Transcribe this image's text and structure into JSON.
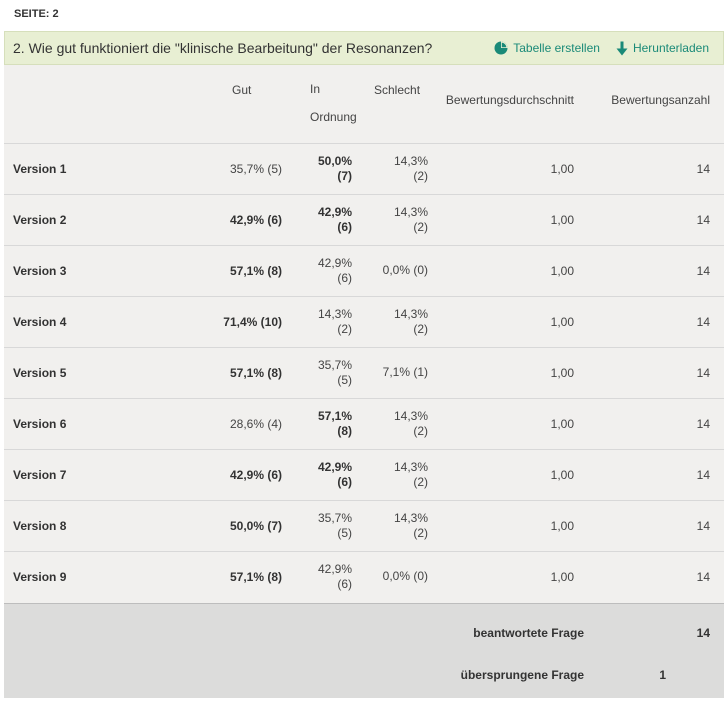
{
  "page": {
    "label": "SEITE: 2"
  },
  "question": {
    "title": "2. Wie gut funktioniert die \"klinische Bearbeitung\" der Resonanzen?",
    "actions": [
      {
        "label": "Tabelle erstellen",
        "icon": "pie-chart-icon"
      },
      {
        "label": "Herunterladen",
        "icon": "download-arrow-icon"
      }
    ]
  },
  "colors": {
    "accent": "#1a8a78",
    "title_bar": "#e8efd3",
    "table_bg": "#f1f0ee",
    "footer_bg": "#dcdcdb"
  },
  "table": {
    "headers": {
      "label": "",
      "gut": "Gut",
      "ok_line1": "In",
      "ok_line2": "Ordnung",
      "bad": "Schlecht",
      "avg": "Bewertungsdurchschnitt",
      "count": "Bewertungsanzahl"
    },
    "rows": [
      {
        "label": "Version 1",
        "gut": "35,7% (5)",
        "ok1": "50,0%",
        "ok2": "(7)",
        "bad1": "14,3%",
        "bad2": "(2)",
        "avg": "1,00",
        "count": "14",
        "bold": "ok"
      },
      {
        "label": "Version 2",
        "gut": "42,9% (6)",
        "ok1": "42,9%",
        "ok2": "(6)",
        "bad1": "14,3%",
        "bad2": "(2)",
        "avg": "1,00",
        "count": "14",
        "bold": "gut-ok"
      },
      {
        "label": "Version 3",
        "gut": "57,1% (8)",
        "ok1": "42,9%",
        "ok2": "(6)",
        "bad1": "0,0% (0)",
        "bad2": "",
        "avg": "1,00",
        "count": "14",
        "bold": "gut"
      },
      {
        "label": "Version 4",
        "gut": "71,4% (10)",
        "ok1": "14,3%",
        "ok2": "(2)",
        "bad1": "14,3%",
        "bad2": "(2)",
        "avg": "1,00",
        "count": "14",
        "bold": "gut"
      },
      {
        "label": "Version 5",
        "gut": "57,1% (8)",
        "ok1": "35,7%",
        "ok2": "(5)",
        "bad1": "7,1% (1)",
        "bad2": "",
        "avg": "1,00",
        "count": "14",
        "bold": "gut"
      },
      {
        "label": "Version 6",
        "gut": "28,6% (4)",
        "ok1": "57,1%",
        "ok2": "(8)",
        "bad1": "14,3%",
        "bad2": "(2)",
        "avg": "1,00",
        "count": "14",
        "bold": "ok"
      },
      {
        "label": "Version 7",
        "gut": "42,9% (6)",
        "ok1": "42,9%",
        "ok2": "(6)",
        "bad1": "14,3%",
        "bad2": "(2)",
        "avg": "1,00",
        "count": "14",
        "bold": "gut-ok"
      },
      {
        "label": "Version 8",
        "gut": "50,0% (7)",
        "ok1": "35,7%",
        "ok2": "(5)",
        "bad1": "14,3%",
        "bad2": "(2)",
        "avg": "1,00",
        "count": "14",
        "bold": "gut"
      },
      {
        "label": "Version 9",
        "gut": "57,1% (8)",
        "ok1": "42,9%",
        "ok2": "(6)",
        "bad1": "0,0% (0)",
        "bad2": "",
        "avg": "1,00",
        "count": "14",
        "bold": "gut"
      }
    ]
  },
  "footer": {
    "answered_label": "beantwortete Frage",
    "answered_value": "14",
    "skipped_label": "übersprungene Frage",
    "skipped_value": "1"
  }
}
